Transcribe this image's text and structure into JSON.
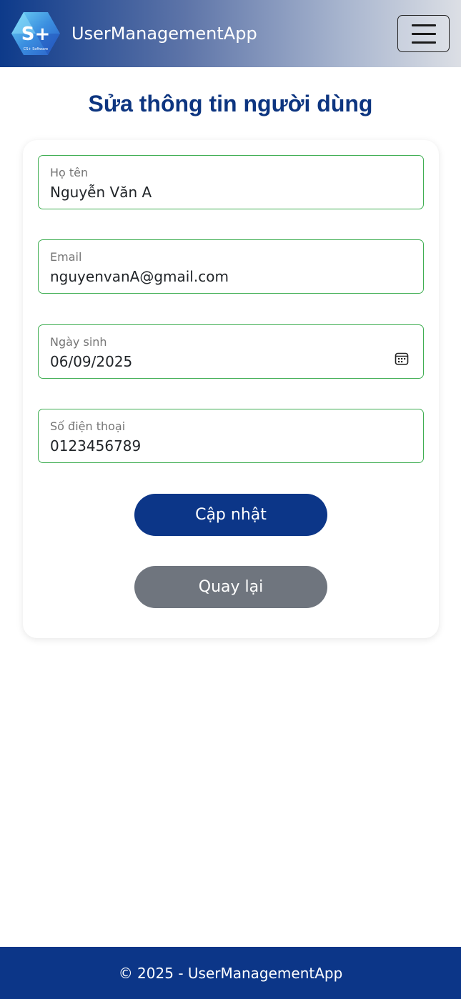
{
  "header": {
    "brand": "UserManagementApp",
    "logo_text": "S+",
    "logo_subtext": "CS+ Software",
    "menu_icon": "hamburger-icon"
  },
  "page": {
    "title": "Sửa thông tin người dùng"
  },
  "form": {
    "full_name": {
      "label": "Họ tên",
      "value": "Nguyễn Văn A"
    },
    "email": {
      "label": "Email",
      "value": "nguyenvanA@gmail.com"
    },
    "birthday": {
      "label": "Ngày sinh",
      "value": "06/09/2025",
      "icon": "calendar-icon"
    },
    "phone": {
      "label": "Số điện thoại",
      "value": "0123456789"
    },
    "update_label": "Cập nhật",
    "back_label": "Quay lại"
  },
  "footer": {
    "text": "© 2025 - UserManagementApp"
  },
  "colors": {
    "primary": "#0c3688",
    "secondary": "#6f757e",
    "field_border": "#3fae52",
    "title": "#0d3580"
  }
}
